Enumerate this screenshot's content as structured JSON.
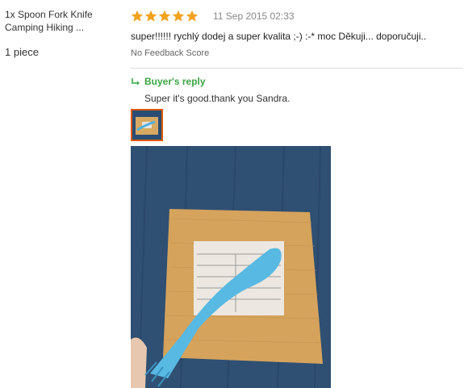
{
  "product": {
    "title": "1x Spoon Fork Knife Camping Hiking ...",
    "quantity": "1 piece"
  },
  "review": {
    "rating": 5,
    "max_rating": 5,
    "date": "11 Sep 2015 02:33",
    "text": "super!!!!!! rychlý dodej a super kvalita ;-) :-* moc Děkuji... doporučuji..",
    "feedback_score": "No Feedback Score",
    "star_icon": "star-icon",
    "star_color": "#f2a21c"
  },
  "reply": {
    "icon": "reply-arrow-icon",
    "title": "Buyer's reply",
    "text": "Super it's good.thank you Sandra.",
    "title_color": "#3ba543"
  },
  "attachment": {
    "thumb_border_color": "#e05a00",
    "count": 1
  }
}
